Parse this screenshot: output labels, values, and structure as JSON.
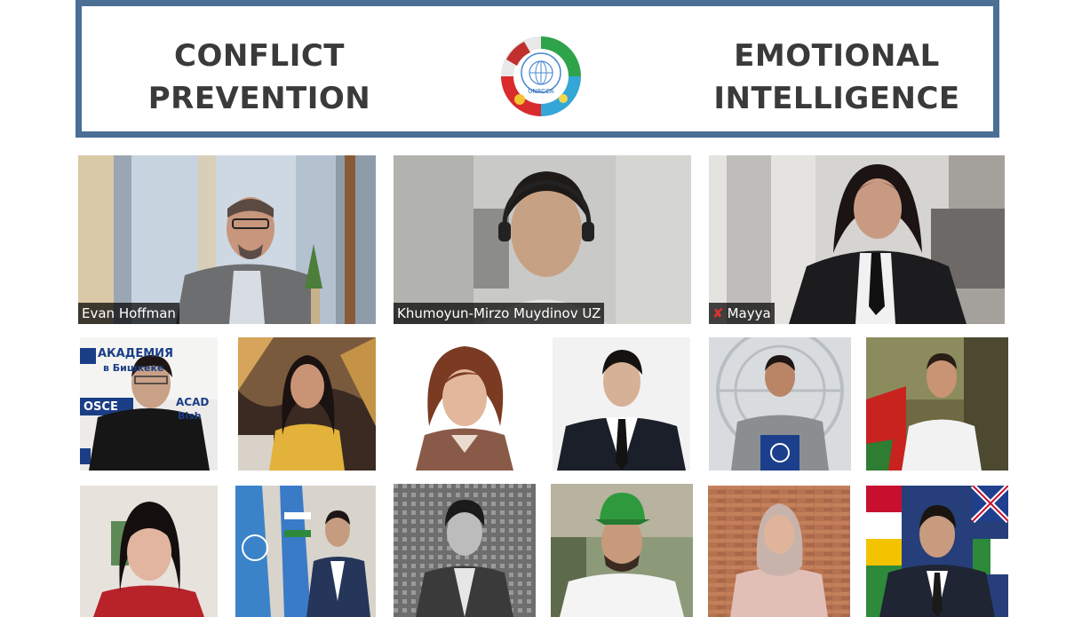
{
  "banner": {
    "title_left": "CONFLICT\nPREVENTION",
    "title_right": "EMOTIONAL\nINTELLIGENCE",
    "logo_text": "UNRCCA"
  },
  "video_tiles": [
    {
      "name": "Evan Hoffman"
    },
    {
      "name": "Khumoyun-Mirzo Muydinov UZ"
    },
    {
      "name": "Mayya"
    }
  ],
  "sign_text": {
    "line1": "АКАДЕМИЯ",
    "line2": "в Бишкеке",
    "line3": "OSCE",
    "line4": "ACAD",
    "line5": "Bish"
  },
  "colors": {
    "banner_border": "#4b6f95",
    "banner_title": "#3a3a3a",
    "nametag_bg": "#000000",
    "mic_muted": "#e0322e"
  }
}
